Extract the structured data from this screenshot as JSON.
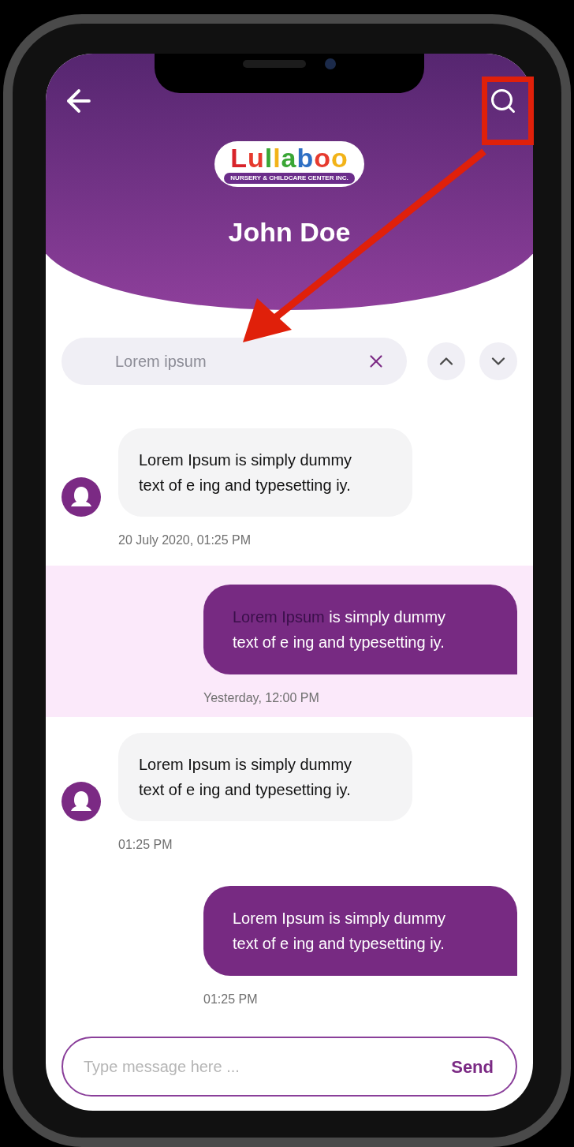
{
  "header": {
    "title": "John Doe",
    "logo": {
      "name": "Lullaboo",
      "tagline": "NURSERY & CHILDCARE CENTER INC."
    }
  },
  "search": {
    "value": "Lorem ipsum"
  },
  "messages": [
    {
      "kind": "received",
      "selected": false,
      "parts": [
        {
          "text": "Lorem Ipsum is simply dummy text of e ing and typesetting iy.",
          "match": false
        }
      ],
      "time": "20 July 2020, 01:25 PM"
    },
    {
      "kind": "sent",
      "selected": true,
      "parts": [
        {
          "text": "Lorem Ipsum",
          "match": true
        },
        {
          "text": " is simply dummy text of e ing and typesetting iy.",
          "match": false
        }
      ],
      "time": "Yesterday, 12:00 PM"
    },
    {
      "kind": "received",
      "selected": false,
      "parts": [
        {
          "text": "Lorem Ipsum is simply dummy text of e ing and typesetting iy.",
          "match": false
        }
      ],
      "time": "01:25 PM"
    },
    {
      "kind": "sent",
      "selected": false,
      "parts": [
        {
          "text": "Lorem Ipsum is simply dummy text of e ing and typesetting iy.",
          "match": false
        }
      ],
      "time": "01:25 PM"
    }
  ],
  "composer": {
    "placeholder": "Type message here ...",
    "send": "Send"
  }
}
